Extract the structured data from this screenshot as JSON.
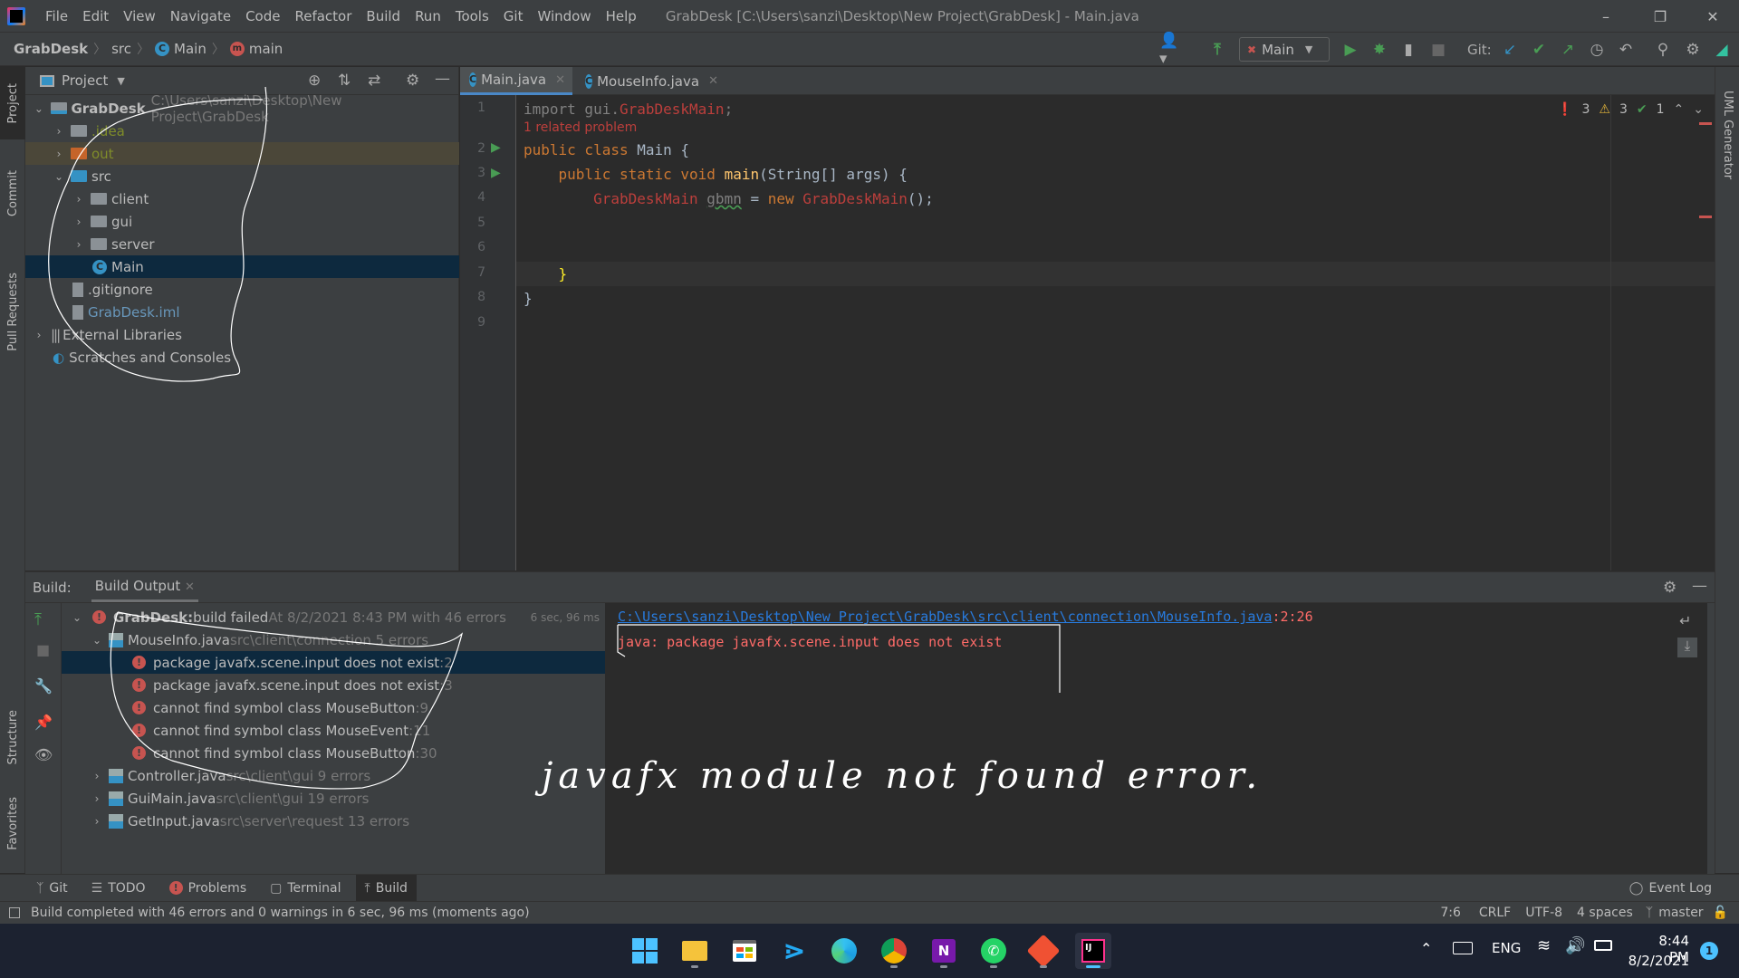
{
  "window": {
    "title": "GrabDesk [C:\\Users\\sanzi\\Desktop\\New Project\\GrabDesk] - Main.java",
    "menu": [
      "File",
      "Edit",
      "View",
      "Navigate",
      "Code",
      "Refactor",
      "Build",
      "Run",
      "Tools",
      "Git",
      "Window",
      "Help"
    ],
    "controls": {
      "minimize": "–",
      "restore": "❐",
      "close": "✕"
    }
  },
  "navbar": {
    "breadcrumb": [
      "GrabDesk",
      "src",
      "Main",
      "main"
    ],
    "run_config": "Main",
    "git_label": "Git:"
  },
  "left_rail": {
    "tabs": [
      "Project",
      "Commit",
      "Pull Requests",
      "Structure",
      "Favorites"
    ]
  },
  "right_rail": {
    "tabs": [
      "UML Generator"
    ]
  },
  "project": {
    "header": "Project",
    "tree": [
      {
        "label": "GrabDesk",
        "hint": "C:\\Users\\sanzi\\Desktop\\New Project\\GrabDesk",
        "depth": 0,
        "expanded": true,
        "type": "module"
      },
      {
        "label": ".idea",
        "depth": 1,
        "expanded": false,
        "type": "folder"
      },
      {
        "label": "out",
        "depth": 1,
        "expanded": false,
        "type": "excluded"
      },
      {
        "label": "src",
        "depth": 1,
        "expanded": true,
        "type": "source"
      },
      {
        "label": "client",
        "depth": 2,
        "expanded": false,
        "type": "package"
      },
      {
        "label": "gui",
        "depth": 2,
        "expanded": false,
        "type": "package"
      },
      {
        "label": "server",
        "depth": 2,
        "expanded": false,
        "type": "package"
      },
      {
        "label": "Main",
        "depth": 2,
        "type": "class",
        "selected": true
      },
      {
        "label": ".gitignore",
        "depth": 1,
        "type": "file"
      },
      {
        "label": "GrabDesk.iml",
        "depth": 1,
        "type": "iml"
      },
      {
        "label": "External Libraries",
        "depth": 0,
        "expanded": false,
        "type": "library"
      },
      {
        "label": "Scratches and Consoles",
        "depth": 0,
        "type": "scratch"
      }
    ]
  },
  "editor": {
    "tabs": [
      {
        "label": "Main.java",
        "active": true
      },
      {
        "label": "MouseInfo.java",
        "active": false
      }
    ],
    "line_numbers": [
      "1",
      "2",
      "3",
      "4",
      "5",
      "6",
      "7",
      "8",
      "9"
    ],
    "related_problem": "1 related problem",
    "inspections": {
      "errors": "3",
      "warnings": "3",
      "typos": "1"
    },
    "code": {
      "l1_a": "import gui.",
      "l1_b": "GrabDeskMain",
      "l1_c": ";",
      "l2_a": "public class ",
      "l2_b": "Main {",
      "l3_a": "    public static void ",
      "l3_b": "main",
      "l3_c": "(String[] args) {",
      "l4_a": "        GrabDeskMain ",
      "l4_b": "gbmn",
      "l4_c": " = ",
      "l4_d": "new ",
      "l4_e": "GrabDeskMain",
      "l4_f": "();",
      "l7": "    }",
      "l8": "}"
    }
  },
  "build": {
    "label": "Build:",
    "tab": "Build Output",
    "rows": [
      {
        "bold": "GrabDesk:",
        "text": " build failed",
        "hint": " At 8/2/2021 8:43 PM with 46 errors",
        "time": "6 sec, 96 ms"
      },
      {
        "text": "MouseInfo.java",
        "hint": " src\\client\\connection 5 errors"
      },
      {
        "text": "package javafx.scene.input does not exist",
        "hint": " :2",
        "selected": true
      },
      {
        "text": "package javafx.scene.input does not exist",
        "hint": " :3"
      },
      {
        "text": "cannot find symbol class MouseButton",
        "hint": " :9"
      },
      {
        "text": "cannot find symbol class MouseEvent",
        "hint": " :11"
      },
      {
        "text": "cannot find symbol class MouseButton",
        "hint": " :30"
      },
      {
        "text": "Controller.java",
        "hint": " src\\client\\gui 9 errors"
      },
      {
        "text": "GuiMain.java",
        "hint": " src\\client\\gui 19 errors"
      },
      {
        "text": "GetInput.java",
        "hint": " src\\server\\request 13 errors"
      }
    ],
    "console": {
      "link": "C:\\Users\\sanzi\\Desktop\\New Project\\GrabDesk\\src\\client\\connection\\MouseInfo.java",
      "position": ":2:26",
      "message": "java: package javafx.scene.input does not exist"
    }
  },
  "annotation": {
    "handwritten": "javafx module not found error."
  },
  "tool_tabs": [
    "Git",
    "TODO",
    "Problems",
    "Terminal",
    "Build"
  ],
  "event_log": "Event Log",
  "status": {
    "message": "Build completed with 46 errors and 0 warnings in 6 sec, 96 ms (moments ago)",
    "caret": "7:6",
    "line_sep": "CRLF",
    "encoding": "UTF-8",
    "indent": "4 spaces",
    "branch": "master"
  },
  "taskbar": {
    "apps": [
      "Start",
      "File Explorer",
      "Microsoft Store",
      "VS Code",
      "Edge",
      "Chrome",
      "OneNote",
      "WhatsApp",
      "Git GUI",
      "IntelliJ IDEA"
    ],
    "lang": "ENG",
    "time": "8:44 PM",
    "date": "8/2/2021",
    "notifications": "1"
  },
  "colors": {
    "accent": "#4a88c7",
    "error": "#c75450",
    "success": "#499c54",
    "selection": "#0d293e"
  }
}
